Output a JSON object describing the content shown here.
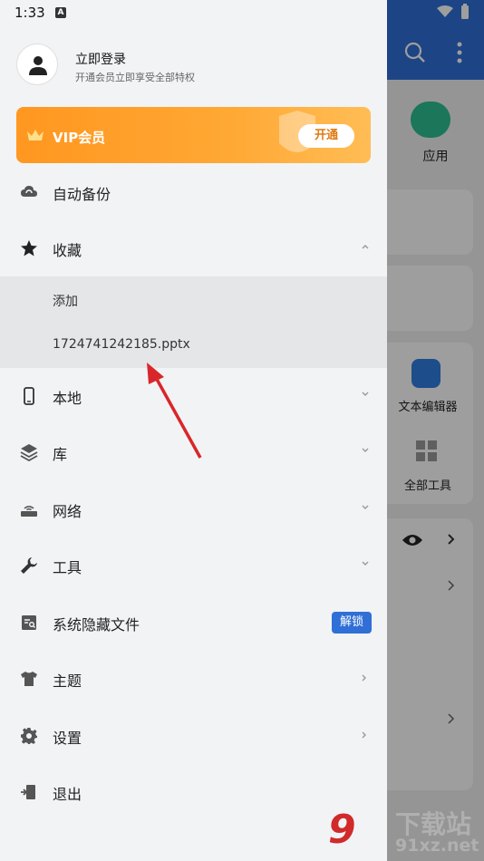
{
  "status_bar": {
    "time": "1:33",
    "indicator": "A"
  },
  "profile": {
    "title": "立即登录",
    "subtitle": "开通会员立即享受全部特权",
    "avatar_icon": "person-icon"
  },
  "vip": {
    "label": "VIP会员",
    "button": "开通",
    "icon": "crown-icon"
  },
  "menu": {
    "auto_backup": "自动备份",
    "favorites": "收藏",
    "favorites_children": [
      "添加",
      "1724741242185.pptx"
    ],
    "local": "本地",
    "library": "库",
    "network": "网络",
    "tools": "工具",
    "hidden_files": "系统隐藏文件",
    "hidden_files_badge": "解锁",
    "theme": "主题",
    "settings": "设置",
    "exit": "退出"
  },
  "background_app": {
    "apps_label": "应用",
    "text_editor": "文本编辑器",
    "all_tools": "全部工具"
  },
  "watermark": {
    "line1": "下载站",
    "line2": "91xz.net",
    "logo": "9"
  },
  "colors": {
    "accent": "#2f6fd6",
    "vip_orange": "#ffa22a",
    "arrow_red": "#d9262a"
  }
}
